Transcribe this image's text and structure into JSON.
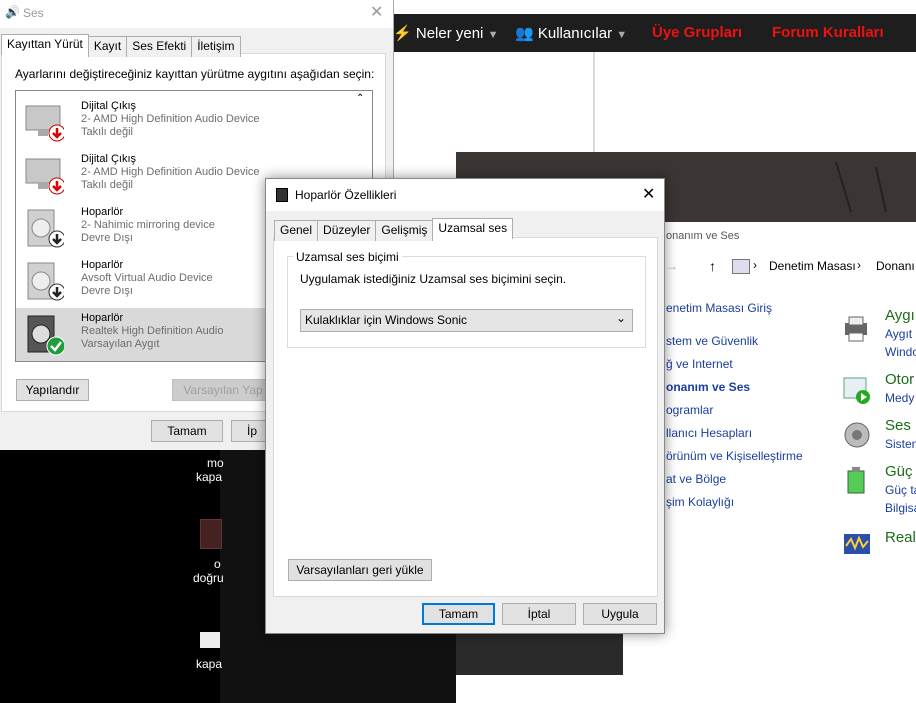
{
  "forum": {
    "nav": [
      "Neler yeni",
      "Kullanıcılar",
      "Üye Grupları",
      "Forum Kuralları"
    ]
  },
  "control_panel": {
    "title": "onanım ve Ses",
    "address": [
      "Denetim Masası",
      "Donanı"
    ],
    "links": [
      "enetim Masası Giriş",
      "stem ve Güvenlik",
      "ğ ve Internet",
      "onanım ve Ses",
      "ogramlar",
      "llanıcı Hesapları",
      "örünüm ve Kişiselleştirme",
      "at ve Bölge",
      "şim Kolaylığı"
    ],
    "categories": [
      {
        "title": "Aygı",
        "subs": [
          "Aygıt",
          "Windo"
        ]
      },
      {
        "title": "Otor",
        "subs": [
          "Medy"
        ]
      },
      {
        "title": "Ses",
        "subs": [
          "Sisten"
        ]
      },
      {
        "title": "Güç",
        "subs": [
          "Güç ta",
          "Bilgisa"
        ]
      },
      {
        "title": "Real",
        "subs": []
      }
    ]
  },
  "desktop": {
    "labels": [
      "mo",
      "kapa",
      "o",
      "doğru",
      "kapa"
    ]
  },
  "ses": {
    "title": "Ses",
    "tabs": [
      "Kayıttan Yürüt",
      "Kayıt",
      "Ses Efekti",
      "İletişim"
    ],
    "instruction": "Ayarlarını değiştireceğiniz kayıttan yürütme aygıtını aşağıdan seçin:",
    "devices": [
      {
        "name": "Dijital Çıkış",
        "detail": "2- AMD High Definition Audio Device",
        "status": "Takılı değil",
        "icon": "monitor-unplugged-icon"
      },
      {
        "name": "Dijital Çıkış",
        "detail": "2- AMD High Definition Audio Device",
        "status": "Takılı değil",
        "icon": "monitor-unplugged-icon"
      },
      {
        "name": "Hoparlör",
        "detail": "2- Nahimic mirroring device",
        "status": "Devre Dışı",
        "icon": "speaker-disabled-icon"
      },
      {
        "name": "Hoparlör",
        "detail": "Avsoft Virtual Audio Device",
        "status": "Devre Dışı",
        "icon": "speaker-disabled-icon"
      },
      {
        "name": "Hoparlör",
        "detail": "Realtek High Definition Audio",
        "status": "Varsayılan Aygıt",
        "icon": "speaker-default-icon"
      }
    ],
    "configure": "Yapılandır",
    "set_default": "Varsayılan Yap",
    "ok": "Tamam",
    "cancel": "İp"
  },
  "hop": {
    "title": "Hoparlör Özellikleri",
    "tabs": [
      "Genel",
      "Düzeyler",
      "Gelişmiş",
      "Uzamsal ses"
    ],
    "group_title": "Uzamsal ses biçimi",
    "instruction": "Uygulamak istediğiniz Uzamsal ses biçimini seçin.",
    "selected": "Kulaklıklar için Windows Sonic",
    "restore": "Varsayılanları geri yükle",
    "ok": "Tamam",
    "cancel": "İptal",
    "apply": "Uygula"
  },
  "colors": {
    "accent": "#0078d7",
    "forum_red": "#e11111",
    "link_blue": "#1a3e9f",
    "cp_green": "#1a6d1a"
  }
}
